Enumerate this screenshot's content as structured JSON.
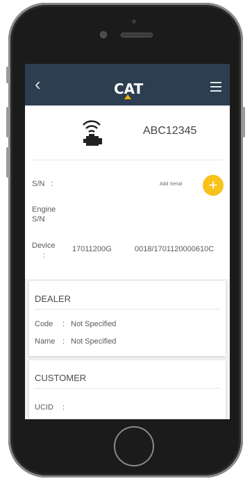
{
  "header": {
    "back_glyph": "‹",
    "logo_text": "CAT",
    "menu_icon": "hamburger-menu-icon"
  },
  "asset": {
    "id": "ABC12345",
    "icon": "connected-engine-icon",
    "sn_label": "S/N",
    "sn_colon": ":",
    "add_serial_label": "Add Serial",
    "add_button_glyph": "+",
    "engine_sn_line1": "Engine",
    "engine_sn_line2": "S/N",
    "engine_sn_colon": ":",
    "device_label": "Device",
    "device_colon": ":",
    "device_value_1": "17011200G",
    "device_value_2": "0018/1701120000610C"
  },
  "dealer": {
    "title": "DEALER",
    "code_label": "Code",
    "code_colon": ":",
    "code_value": "Not Specified",
    "name_label": "Name",
    "name_colon": ":",
    "name_value": "Not Specified"
  },
  "customer": {
    "title": "CUSTOMER",
    "ucid_label": "UCID",
    "ucid_colon": ":"
  },
  "colors": {
    "topbar": "#2d3e50",
    "accent_yellow": "#f8c21a",
    "background": "#f1f1f1"
  }
}
